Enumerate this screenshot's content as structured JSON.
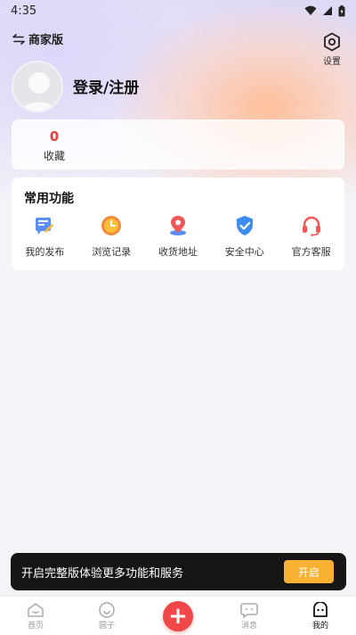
{
  "status": {
    "time": "4:35"
  },
  "header": {
    "merchant_label": "商家版",
    "settings_label": "设置"
  },
  "profile": {
    "login_text": "登录/注册"
  },
  "favorites": {
    "count": "0",
    "label": "收藏"
  },
  "functions": {
    "title": "常用功能",
    "items": [
      {
        "label": "我的发布",
        "icon": "publish-icon"
      },
      {
        "label": "浏览记录",
        "icon": "history-clock-icon"
      },
      {
        "label": "收货地址",
        "icon": "location-pin-icon"
      },
      {
        "label": "安全中心",
        "icon": "shield-check-icon"
      },
      {
        "label": "官方客服",
        "icon": "headset-icon"
      }
    ]
  },
  "banner": {
    "text": "开启完整版体验更多功能和服务",
    "button": "开启"
  },
  "tabbar": {
    "items": [
      {
        "label": "首页",
        "icon": "home-icon"
      },
      {
        "label": "圆子",
        "icon": "circle-icon"
      },
      {
        "label": "",
        "icon": "add-icon"
      },
      {
        "label": "消息",
        "icon": "message-icon"
      },
      {
        "label": "我的",
        "icon": "profile-icon"
      }
    ],
    "active": "我的"
  },
  "colors": {
    "accent_red": "#ef3b3b",
    "banner_button": "#f8b132",
    "add_button": "#f04848"
  }
}
